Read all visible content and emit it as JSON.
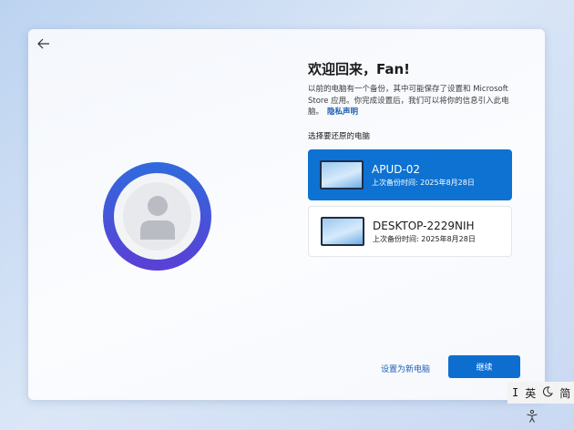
{
  "header": {
    "back_icon": "back-arrow-icon"
  },
  "title": "欢迎回来，Fan!",
  "description": {
    "text": "以前的电脑有一个备份，其中可能保存了设置和 Microsoft Store 应用。你完成设置后，我们可以将你的信息引入此电脑。",
    "privacy_link": "隐私声明"
  },
  "section_label": "选择要还原的电脑",
  "pcs": [
    {
      "name": "APUD-02",
      "backup": "上次备份时间: 2025年8月28日",
      "selected": true
    },
    {
      "name": "DESKTOP-2229NIH",
      "backup": "上次备份时间: 2025年8月28日",
      "selected": false
    }
  ],
  "actions": {
    "set_new_label": "设置为新电脑",
    "continue_label": "继续"
  },
  "ime": {
    "cursor": "I",
    "lang": "英",
    "mode": "简",
    "moon_icon": "moon-icon"
  },
  "accessibility_icon": "accessibility-icon",
  "colors": {
    "accent": "#0d72d1",
    "link": "#1e5fb4",
    "avatar_ring_top": "#2f6bdc",
    "avatar_ring_bottom": "#5b3fd6"
  }
}
